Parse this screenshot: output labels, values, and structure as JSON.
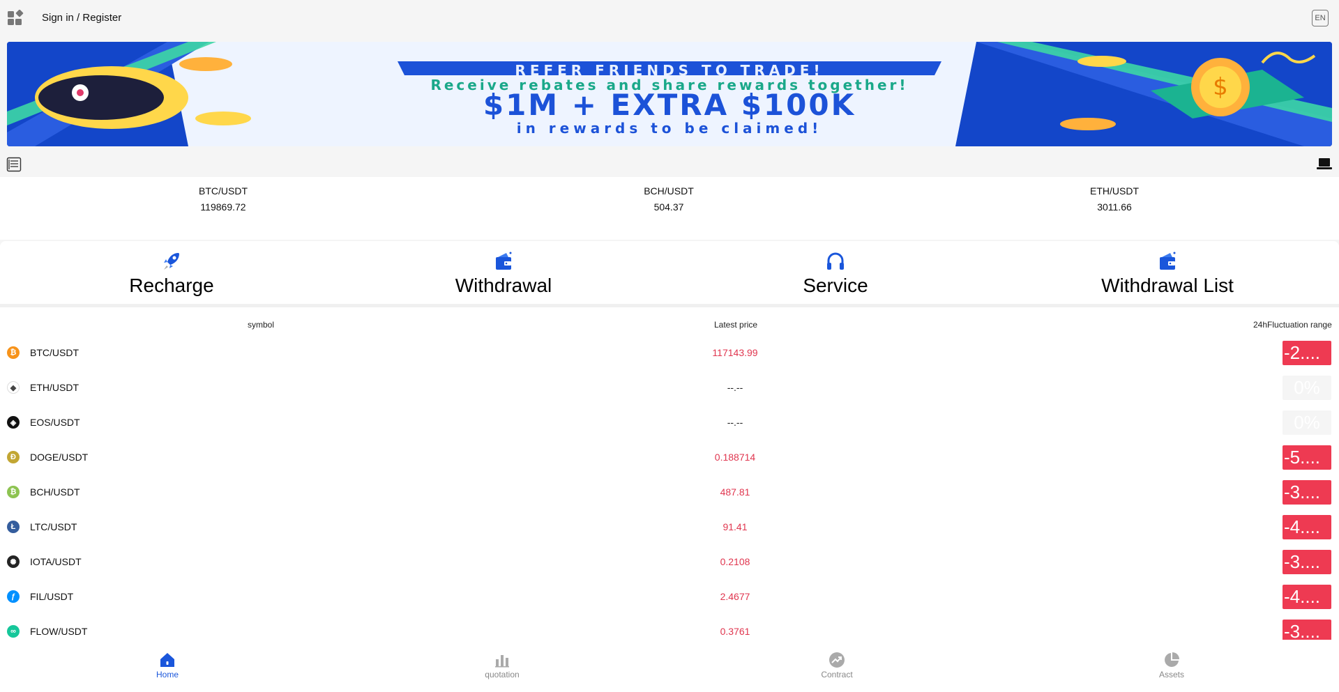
{
  "header": {
    "signin_label": "Sign in / Register",
    "lang_label": "EN",
    "apps_icon": "apps-grid-icon"
  },
  "banner": {
    "line1": "REFER FRIENDS TO TRADE!",
    "line2": "Receive rebates and share rewards together!",
    "line3": "$1M + EXTRA $100K",
    "line4": "in rewards to be claimed!",
    "background_color": "#1346c9"
  },
  "tickers": [
    {
      "symbol": "BTC/USDT",
      "price": "119869.72"
    },
    {
      "symbol": "BCH/USDT",
      "price": "504.37"
    },
    {
      "symbol": "ETH/USDT",
      "price": "3011.66"
    }
  ],
  "quick_actions": [
    {
      "label": "Recharge",
      "icon": "rocket-icon"
    },
    {
      "label": "Withdrawal",
      "icon": "wallet-icon"
    },
    {
      "label": "Service",
      "icon": "headphones-icon"
    },
    {
      "label": "Withdrawal List",
      "icon": "wallet-icon"
    }
  ],
  "market": {
    "headers": {
      "symbol": "symbol",
      "price": "Latest price",
      "change": "24hFluctuation range"
    },
    "rows": [
      {
        "symbol": "BTC/USDT",
        "price": "117143.99",
        "change": "-2....",
        "coin_color": "#f7931a",
        "glyph": "₿"
      },
      {
        "symbol": "ETH/USDT",
        "price": "--.--",
        "change": "0%",
        "coin_color": "#ffffff",
        "glyph": "◆"
      },
      {
        "symbol": "EOS/USDT",
        "price": "--.--",
        "change": "0%",
        "coin_color": "#111111",
        "glyph": "◈"
      },
      {
        "symbol": "DOGE/USDT",
        "price": "0.188714",
        "change": "-5....",
        "coin_color": "#c2a633",
        "glyph": "Ð"
      },
      {
        "symbol": "BCH/USDT",
        "price": "487.81",
        "change": "-3....",
        "coin_color": "#8dc351",
        "glyph": "₿"
      },
      {
        "symbol": "LTC/USDT",
        "price": "91.41",
        "change": "-4....",
        "coin_color": "#345d9d",
        "glyph": "Ł"
      },
      {
        "symbol": "IOTA/USDT",
        "price": "0.2108",
        "change": "-3....",
        "coin_color": "#242424",
        "glyph": "✺"
      },
      {
        "symbol": "FIL/USDT",
        "price": "2.4677",
        "change": "-4....",
        "coin_color": "#0090ff",
        "glyph": "ƒ"
      },
      {
        "symbol": "FLOW/USDT",
        "price": "0.3761",
        "change": "-3....",
        "coin_color": "#16c79a",
        "glyph": "∞"
      }
    ],
    "down_color": "#ee3a52"
  },
  "tabbar": [
    {
      "label": "Home",
      "icon": "home-icon",
      "active": true
    },
    {
      "label": "quotation",
      "icon": "bar-chart-icon",
      "active": false
    },
    {
      "label": "Contract",
      "icon": "trend-icon",
      "active": false
    },
    {
      "label": "Assets",
      "icon": "pie-chart-icon",
      "active": false
    }
  ],
  "colors": {
    "accent": "#1a56db",
    "down": "#e0364f"
  }
}
